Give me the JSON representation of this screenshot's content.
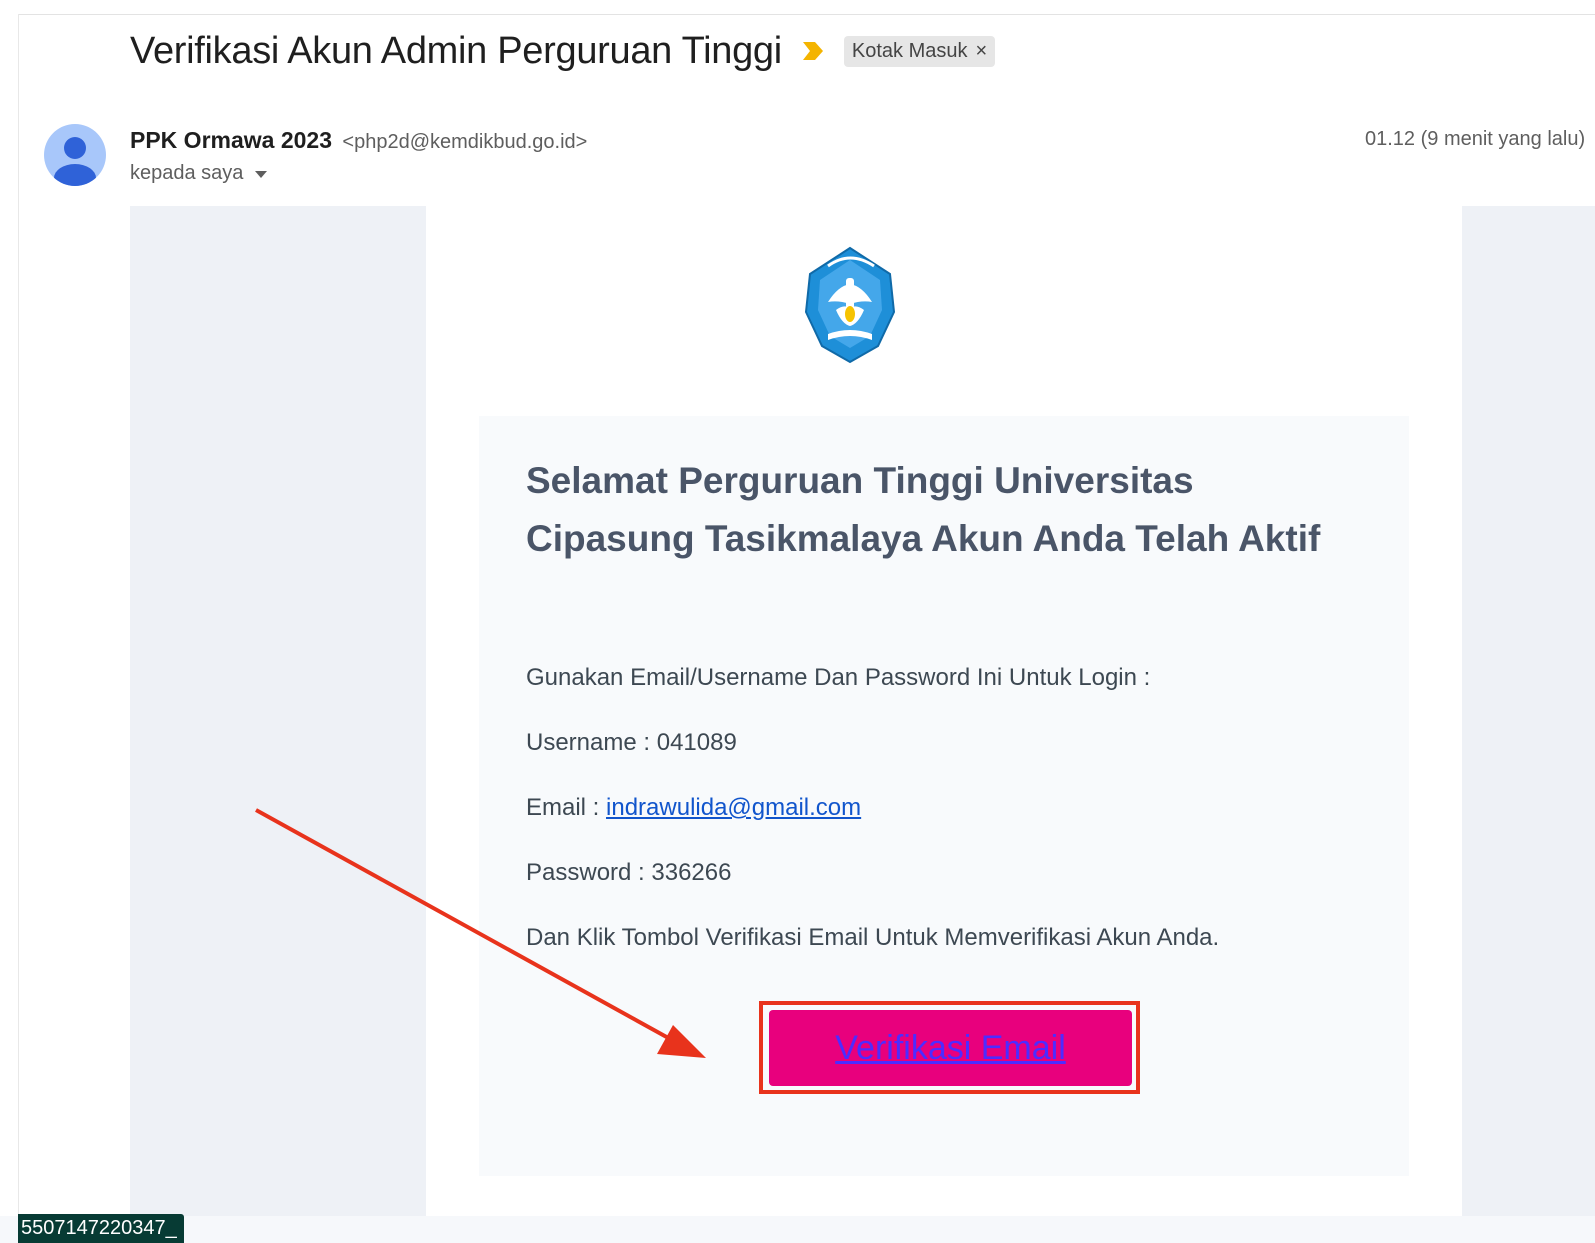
{
  "email": {
    "subject": "Verifikasi Akun Admin Perguruan Tinggi",
    "label": "Kotak Masuk",
    "label_close": "×",
    "sender_name": "PPK Ormawa 2023",
    "sender_email": "<php2d@kemdikbud.go.id>",
    "recipient": "kepada saya",
    "timestamp": "01.12 (9 menit yang lalu)"
  },
  "message": {
    "heading": "Selamat Perguruan Tinggi Universitas Cipasung Tasikmalaya Akun Anda Telah Aktif",
    "intro": "Gunakan Email/Username Dan Password Ini Untuk Login :",
    "username_label": "Username : ",
    "username_value": "041089",
    "email_label": "Email : ",
    "email_value": "indrawulida@gmail.com",
    "password_label": "Password : ",
    "password_value": "336266",
    "instruction": "Dan Klik Tombol Verifikasi Email Untuk Memverifikasi Akun Anda.",
    "button_label": "Verifikasi Email"
  },
  "footer": {
    "tag_text": "5507147220347_"
  },
  "icons": {
    "important_marker": "important-marker-icon",
    "avatar": "default-avatar-icon",
    "logo": "tut-wuri-handayani-logo",
    "annotation": "red-arrow-annotation"
  },
  "colors": {
    "button_bg": "#e8007d",
    "button_text": "#4d2cff",
    "annotation_red": "#e8331c",
    "important_yellow": "#f4b400",
    "heading_text": "#4a5568"
  }
}
